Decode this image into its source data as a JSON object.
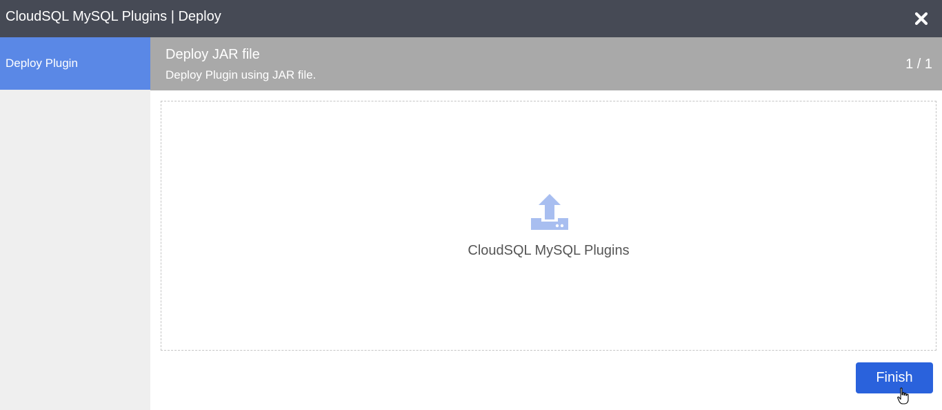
{
  "window": {
    "title": "CloudSQL MySQL Plugins | Deploy",
    "close_icon": "close-icon"
  },
  "sidebar": {
    "steps": [
      {
        "label": "Deploy Plugin",
        "active": true
      }
    ]
  },
  "step_header": {
    "title": "Deploy JAR file",
    "description": "Deploy Plugin using JAR file.",
    "counter": "1 / 1"
  },
  "dropzone": {
    "icon": "upload-icon",
    "label": "CloudSQL MySQL Plugins"
  },
  "footer": {
    "finish_label": "Finish"
  },
  "colors": {
    "titlebar": "#464a55",
    "sidebar_active": "#5a88e6",
    "header": "#a9a9a9",
    "primary_button": "#2a62dc",
    "upload_icon": "#a8bef0"
  }
}
